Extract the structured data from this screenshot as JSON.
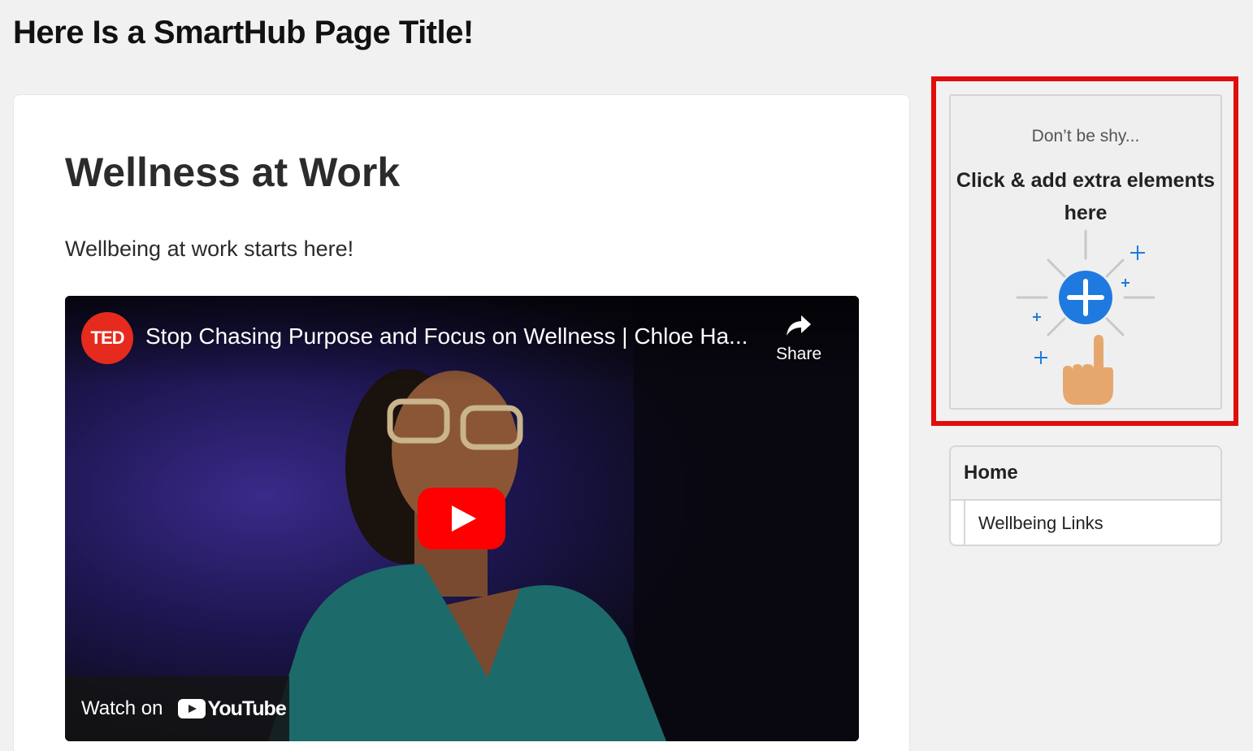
{
  "page": {
    "title": "Here Is a SmartHub Page Title!"
  },
  "main": {
    "heading": "Wellness at Work",
    "text": "Wellbeing at work starts here!",
    "video": {
      "channel_badge": "TED",
      "title": "Stop Chasing Purpose and Focus on Wellness | Chloe Ha...",
      "share_label": "Share",
      "watch_on_label": "Watch on",
      "platform_logo_text": "YouTube",
      "play_icon": "play-icon"
    }
  },
  "add_element": {
    "hint": "Don’t be shy...",
    "cta": "Click & add extra elements here",
    "highlight_color": "#e00d0d",
    "accent_color": "#1f7ae0"
  },
  "nav": {
    "home_label": "Home",
    "items": [
      {
        "label": "Wellbeing Links"
      }
    ]
  }
}
